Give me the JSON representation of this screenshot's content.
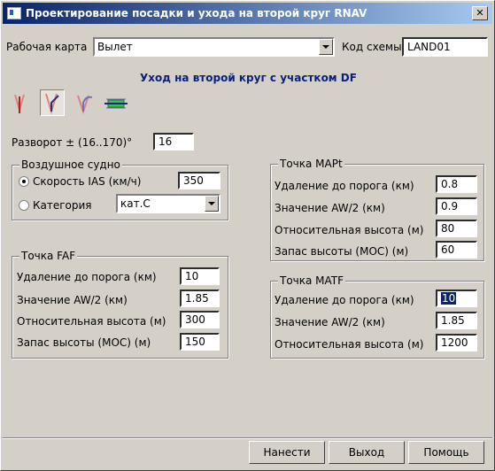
{
  "window": {
    "title": "Проектирование посадки и ухода на второй круг RNAV"
  },
  "header": {
    "map_label": "Рабочая карта",
    "map_value": "Вылет",
    "scheme_label": "Код схемы",
    "scheme_value": "LAND01"
  },
  "heading": "Уход на второй круг с участком DF",
  "toolbar": {
    "icons": [
      "straight-approach-icon",
      "turn-approach-icon",
      "curved-turn-icon",
      "df-segment-icon"
    ],
    "active_index": 1
  },
  "turn": {
    "label": "Разворот ± (16..170)°",
    "value": "16"
  },
  "aircraft": {
    "title": "Воздушное судно",
    "ias_label": "Скорость IAS (км/ч)",
    "ias_value": "350",
    "ias_selected": true,
    "category_label": "Категория",
    "category_value": "кат.C"
  },
  "faf": {
    "title": "Точка FAF",
    "rows": [
      {
        "label": "Удаление до порога (км)",
        "value": "10"
      },
      {
        "label": "Значение AW/2 (км)",
        "value": "1.85"
      },
      {
        "label": "Относительная высота (м)",
        "value": "300"
      },
      {
        "label": "Запас высоты (МОС) (м)",
        "value": "150"
      }
    ]
  },
  "mapt": {
    "title": "Точка MAPt",
    "rows": [
      {
        "label": "Удаление до порога (км)",
        "value": "0.8"
      },
      {
        "label": "Значение AW/2 (км)",
        "value": "0.9"
      },
      {
        "label": "Относительная высота (м)",
        "value": "80"
      },
      {
        "label": "Запас высоты (МОС) (м)",
        "value": "60"
      }
    ]
  },
  "matf": {
    "title": "Точка MATF",
    "rows": [
      {
        "label": "Удаление до порога (км)",
        "value": "10"
      },
      {
        "label": "Значение AW/2 (км)",
        "value": "1.85"
      },
      {
        "label": "Относительная высота (м)",
        "value": "1200"
      }
    ]
  },
  "buttons": {
    "apply": "Нанести",
    "exit": "Выход",
    "help": "Помощь"
  }
}
